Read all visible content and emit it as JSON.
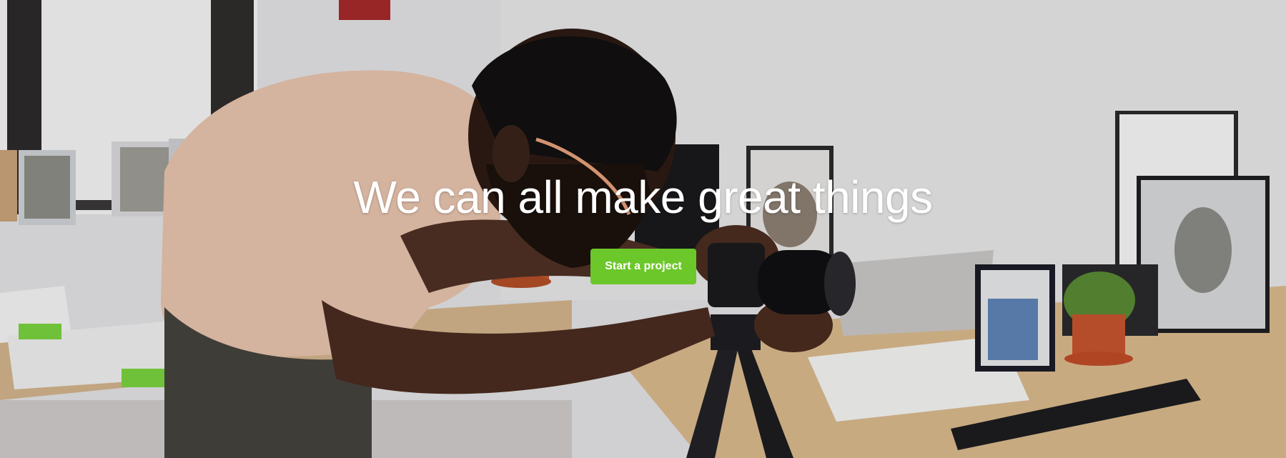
{
  "hero": {
    "headline": "We can all make great things",
    "cta_label": "Start a project",
    "cta_color": "#6cc72a",
    "photo_alt": ""
  }
}
